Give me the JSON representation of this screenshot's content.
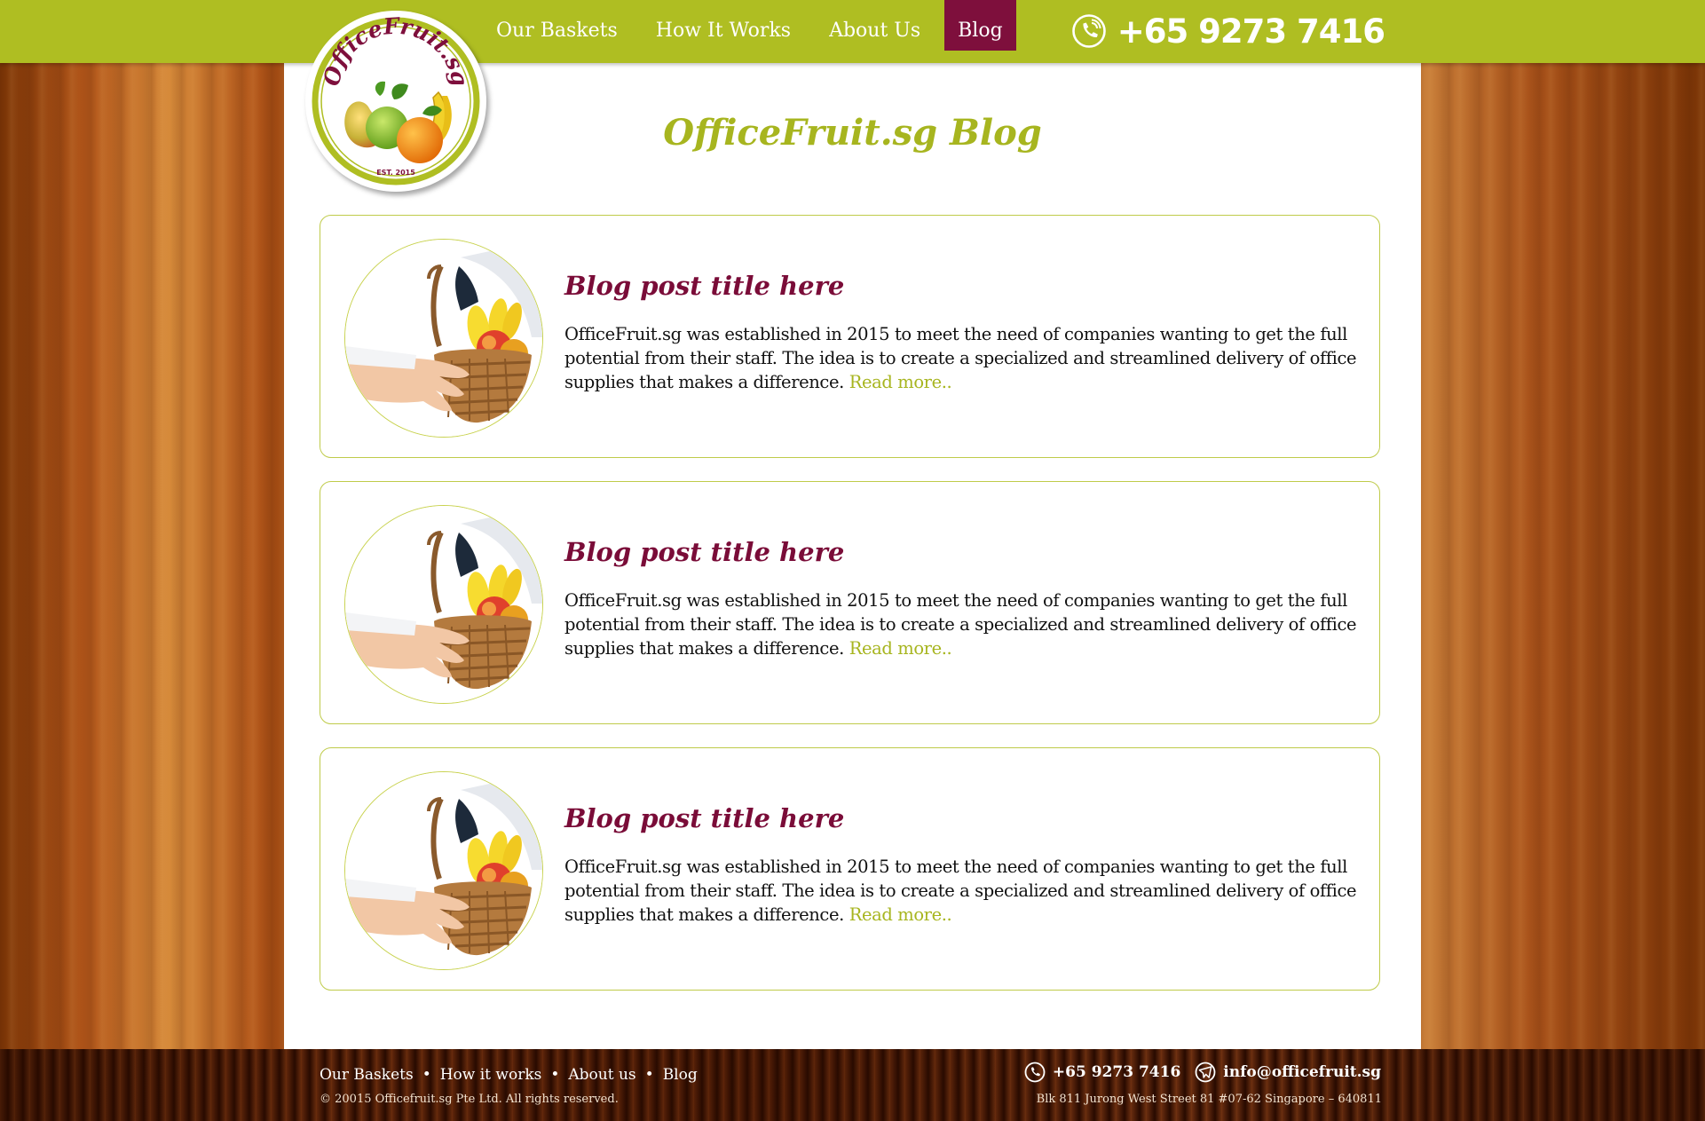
{
  "colors": {
    "accent_green": "#afbe22",
    "title_green": "#a7b51f",
    "brand_burgundy": "#7e0f3c",
    "post_title": "#7a0c38"
  },
  "logo": {
    "text": "OfficeFruit.sg",
    "est": "EST. 2015",
    "icon": "fruit-logo"
  },
  "nav": {
    "items": [
      {
        "label": "Our Baskets"
      },
      {
        "label": "How It Works"
      },
      {
        "label": "About Us"
      },
      {
        "label": "Blog",
        "active": true
      }
    ]
  },
  "header": {
    "phone": "+65 9273 7416",
    "phone_icon": "phone-icon"
  },
  "page": {
    "title": "OfficeFruit.sg Blog"
  },
  "posts": [
    {
      "title": "Blog post title here",
      "excerpt": "OfficeFruit.sg was established in 2015 to meet the need of companies wanting to get the full potential from their staff. The idea is to create a specialized and streamlined delivery of office supplies that makes a difference.",
      "read_more": "Read more..",
      "image": "fruit-basket"
    },
    {
      "title": "Blog post title here",
      "excerpt": "OfficeFruit.sg was established in 2015 to meet the need of companies wanting to get the full potential from their staff. The idea is to create a specialized and streamlined delivery of office supplies that makes a difference.",
      "read_more": "Read more..",
      "image": "fruit-basket"
    },
    {
      "title": "Blog post title here",
      "excerpt": "OfficeFruit.sg was established in 2015 to meet the need of companies wanting to get the full potential from their staff. The idea is to create a specialized and streamlined delivery of office supplies that makes a difference.",
      "read_more": "Read more..",
      "image": "fruit-basket"
    }
  ],
  "footer": {
    "links": [
      {
        "label": "Our Baskets"
      },
      {
        "label": "How it works"
      },
      {
        "label": "About us"
      },
      {
        "label": "Blog"
      }
    ],
    "separator": "•",
    "copyright": "© 20015 Officefruit.sg Pte Ltd. All rights reserved.",
    "phone": "+65 9273 7416",
    "email": "info@officefruit.sg",
    "address": "Blk 811 Jurong West Street 81 #07-62 Singapore – 640811",
    "icons": [
      "phone-icon",
      "email-icon"
    ]
  }
}
